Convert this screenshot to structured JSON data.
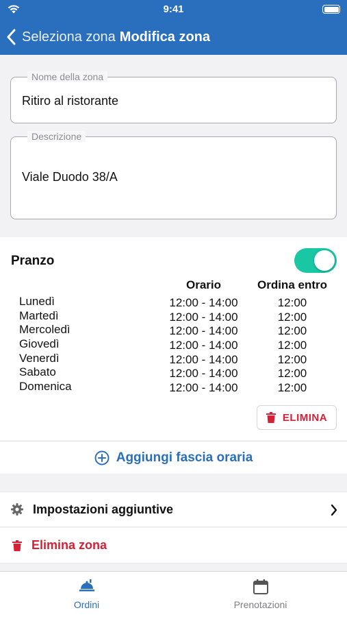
{
  "status": {
    "time": "9:41"
  },
  "nav": {
    "back_label": "Seleziona zona",
    "title": "Modifica zona"
  },
  "form": {
    "name_label": "Nome della zona",
    "name_value": "Ritiro al ristorante",
    "desc_label": "Descrizione",
    "desc_value": "Viale Duodo 38/A"
  },
  "slot": {
    "title": "Pranzo",
    "enabled": true,
    "col_hours": "Orario",
    "col_until": "Ordina entro",
    "rows": [
      {
        "day": "Lunedì",
        "hours": "12:00 - 14:00",
        "until": "12:00"
      },
      {
        "day": "Martedì",
        "hours": "12:00 - 14:00",
        "until": "12:00"
      },
      {
        "day": "Mercoledì",
        "hours": "12:00 - 14:00",
        "until": "12:00"
      },
      {
        "day": "Giovedì",
        "hours": "12:00 - 14:00",
        "until": "12:00"
      },
      {
        "day": "Venerdì",
        "hours": "12:00 - 14:00",
        "until": "12:00"
      },
      {
        "day": "Sabato",
        "hours": "12:00 - 14:00",
        "until": "12:00"
      },
      {
        "day": "Domenica",
        "hours": "12:00 - 14:00",
        "until": "12:00"
      }
    ],
    "delete_label": "ELIMINA"
  },
  "add_slot_label": "Aggiungi fascia oraria",
  "settings_label": "Impostazioni aggiuntive",
  "delete_zone_label": "Elimina zona",
  "tabs": [
    {
      "label": "Ordini",
      "icon": "food-tray-icon",
      "active": true
    },
    {
      "label": "Prenotazioni",
      "icon": "calendar-icon",
      "active": false
    }
  ],
  "colors": {
    "primary": "#2a6fbd",
    "danger": "#d62035",
    "toggle_on": "#19c7a5"
  }
}
